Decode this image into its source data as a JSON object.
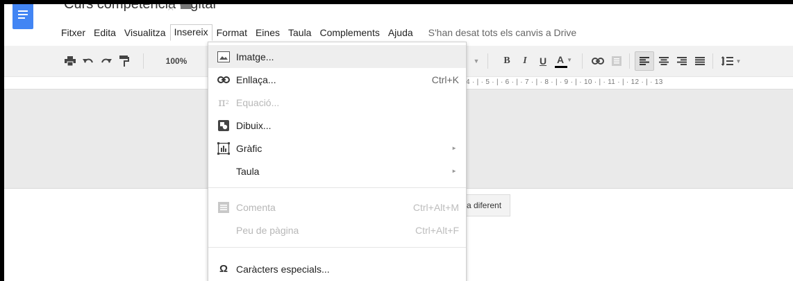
{
  "header": {
    "doc_title": "Curs competència digital"
  },
  "menubar": {
    "items": [
      "Fitxer",
      "Edita",
      "Visualitza",
      "Insereix",
      "Format",
      "Eines",
      "Taula",
      "Complements",
      "Ajuda"
    ],
    "active_item": "Insereix",
    "save_status": "S'han desat tots els canvis a Drive"
  },
  "toolbar": {
    "zoom": "100%",
    "bold": "B",
    "italic": "I",
    "underline": "U",
    "text_color": "A",
    "text_color_value": "#000000",
    "icons": [
      "print-icon",
      "undo-icon",
      "redo-icon",
      "paint-format-icon",
      "link-icon",
      "comment-icon",
      "align-left-icon",
      "align-center-icon",
      "align-right-icon",
      "justify-icon",
      "line-spacing-icon"
    ]
  },
  "ruler": {
    "numbers": "4 · | · 5 · | · 6 · | · 7 · | · 8 · | · 9 · | · 10 · | · 11 · | · 12 · | · 13"
  },
  "canvas": {
    "chip_text": "a diferent"
  },
  "insert_menu": {
    "items": [
      {
        "label": "Imatge...",
        "shortcut": "",
        "icon": "image-icon",
        "state": "highlighted"
      },
      {
        "label": "Enllaça...",
        "shortcut": "Ctrl+K",
        "icon": "link-icon",
        "state": "enabled"
      },
      {
        "label": "Equació...",
        "shortcut": "",
        "icon": "equation-icon",
        "state": "disabled"
      },
      {
        "label": "Dibuix...",
        "shortcut": "",
        "icon": "drawing-icon",
        "state": "enabled"
      },
      {
        "label": "Gràfic",
        "shortcut": "",
        "icon": "chart-icon",
        "state": "enabled",
        "submenu": true
      },
      {
        "label": "Taula",
        "shortcut": "",
        "icon": "",
        "state": "enabled",
        "submenu": true
      },
      {
        "label": "Comenta",
        "shortcut": "Ctrl+Alt+M",
        "icon": "comment-icon",
        "state": "disabled"
      },
      {
        "label": "Peu de pàgina",
        "shortcut": "Ctrl+Alt+F",
        "icon": "",
        "state": "disabled"
      },
      {
        "label": "Caràcters especials...",
        "shortcut": "",
        "icon": "omega-icon",
        "state": "enabled"
      }
    ]
  },
  "colors": {
    "brand": "#4285f4",
    "menu_highlight": "#eeeeee",
    "disabled_text": "#b7b7b7",
    "toolbar_bg": "#f1f1f1"
  }
}
